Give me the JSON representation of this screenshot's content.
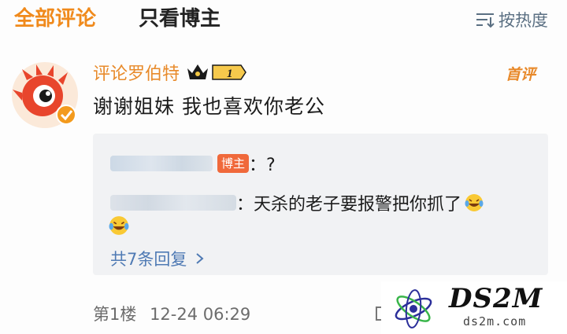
{
  "header": {
    "tab_all": "全部评论",
    "tab_host_only": "只看博主",
    "sort_label": "按热度"
  },
  "comment": {
    "username": "评论罗伯特",
    "level": "1",
    "first_tag": "首评",
    "text": "谢谢姐妹 我也喜欢你老公",
    "floor": "第1楼",
    "timestamp": "12-24 06:29"
  },
  "replies": {
    "reply_1_badge": "博主",
    "reply_1_text": "：?",
    "reply_2_text": "：天杀的老子要报警把你抓了",
    "more_label": "共7条回复"
  },
  "watermark": {
    "logo_text": "DS2M",
    "url": "ds2m.com"
  },
  "colors": {
    "accent": "#f08a1c",
    "link": "#4f7ab4",
    "host_badge": "#f0693b",
    "reply_bg": "#f1f2f4"
  }
}
